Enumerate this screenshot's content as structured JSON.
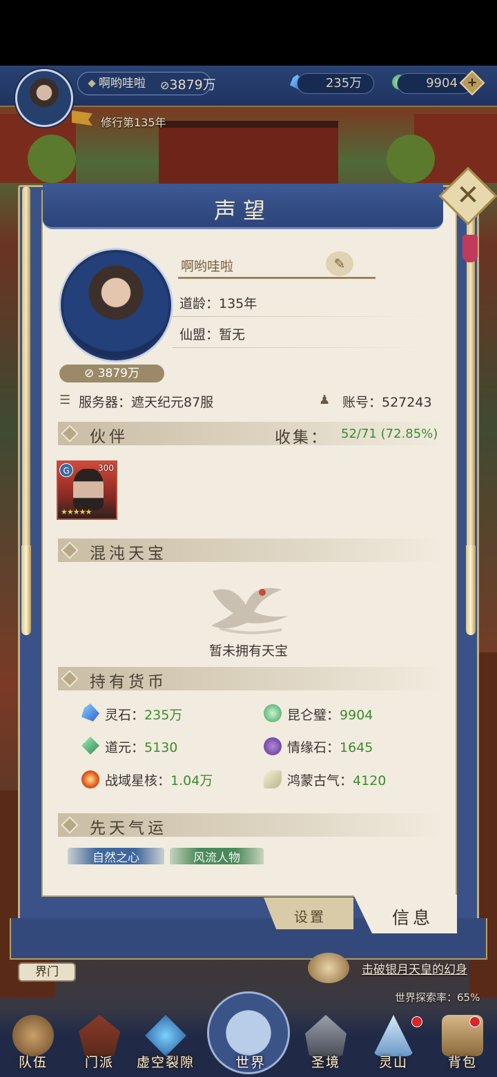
{
  "hud": {
    "player_name": "啊哟哇啦",
    "power": "3879万",
    "spirit_stone": "235万",
    "kunlun_jade": "9904",
    "cultivation_stage": "修行第135年"
  },
  "panel": {
    "title": "声望",
    "close_label": "✕",
    "profile": {
      "name": "啊哟哇啦",
      "dao_age": "道龄：135年",
      "alliance": "仙盟：暂无",
      "power": "3879万",
      "server": "服务器：遮天纪元87服",
      "account": "账号：527243"
    },
    "partners": {
      "header": "伙伴",
      "collect_label": "收集：",
      "collect_value": "52/71 (72.85%)",
      "cards": [
        {
          "level": "300",
          "badge": "G",
          "stars": "★★★★★"
        }
      ]
    },
    "chaos_treasure": {
      "header": "混沌天宝",
      "empty_text": "暂未拥有天宝"
    },
    "currencies": {
      "header": "持有货币",
      "items": [
        {
          "label": "灵石：",
          "value": "235万",
          "icon": "spirit-stone-icon"
        },
        {
          "label": "昆仑璧：",
          "value": "9904",
          "icon": "kunlun-jade-icon"
        },
        {
          "label": "道元：",
          "value": "5130",
          "icon": "dao-essence-icon"
        },
        {
          "label": "情缘石：",
          "value": "1645",
          "icon": "fate-stone-icon"
        },
        {
          "label": "战域星核：",
          "value": "1.04万",
          "icon": "star-core-icon"
        },
        {
          "label": "鸿蒙古气：",
          "value": "4120",
          "icon": "primordial-qi-icon"
        }
      ]
    },
    "innate_fortune": {
      "header": "先天气运",
      "chips": [
        "自然之心",
        "风流人物"
      ]
    },
    "tabs": {
      "settings": "设置",
      "info": "信息"
    }
  },
  "world": {
    "realm_gate": "界门",
    "quest": "击破银月天皇的幻身",
    "explore": "世界探索率：65%"
  },
  "nav": {
    "team": "队伍",
    "sect": "门派",
    "rift": "虚空裂隙",
    "world": "世界",
    "holy": "圣境",
    "spirit_mountain": "灵山",
    "bag": "背包"
  },
  "colors": {
    "accent_green": "#3c8a2e",
    "panel_blue": "#3a5288",
    "paper": "#f1ecdf"
  }
}
